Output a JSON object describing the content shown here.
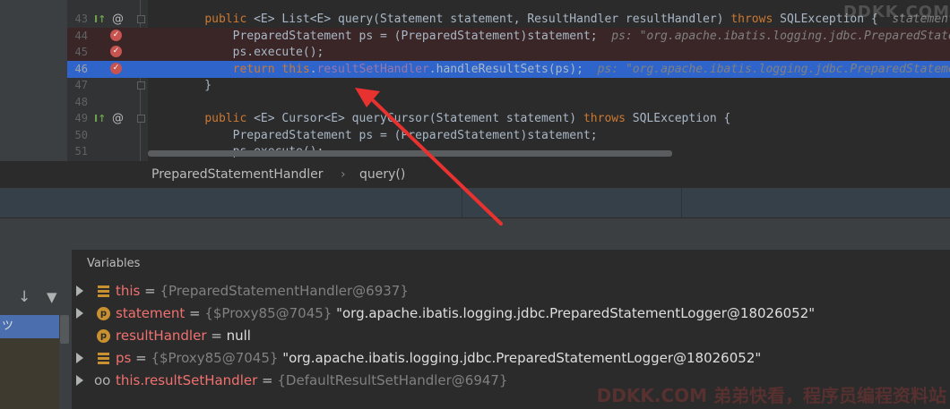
{
  "editor": {
    "watermark": "DDKK.COM",
    "lines": [
      {
        "num": "43",
        "icons": "override",
        "segments": [
          {
            "t": "    "
          },
          {
            "t": "public",
            "c": "kw"
          },
          {
            "t": " <E> List<E> query(Statement statement, ResultHandler resultHandler) "
          },
          {
            "t": "throws",
            "c": "kw"
          },
          {
            "t": " SQLException {  "
          },
          {
            "t": "statement:",
            "c": "cm"
          }
        ]
      },
      {
        "num": "44",
        "icons": "breakpoint",
        "state": "error",
        "segments": [
          {
            "t": "        PreparedStatement ps = (PreparedStatement)statement;  "
          },
          {
            "t": "ps: \"org.apache.ibatis.logging.jdbc.PreparedStatem",
            "c": "cm"
          }
        ]
      },
      {
        "num": "45",
        "icons": "breakpoint",
        "state": "error",
        "segments": [
          {
            "t": "        ps.execute();"
          }
        ]
      },
      {
        "num": "46",
        "icons": "breakpoint",
        "state": "current",
        "segments": [
          {
            "t": "        "
          },
          {
            "t": "return",
            "c": "kw"
          },
          {
            "t": " "
          },
          {
            "t": "this",
            "c": "kw"
          },
          {
            "t": "."
          },
          {
            "t": "resultSetHandler",
            "c": "fld"
          },
          {
            "t": ".handleResultSets(ps);  "
          },
          {
            "t": "ps: \"org.apache.ibatis.logging.jdbc.PreparedStatemen",
            "c": "cm"
          }
        ]
      },
      {
        "num": "47",
        "icons": "fold",
        "segments": [
          {
            "t": "    }"
          }
        ]
      },
      {
        "num": "48",
        "icons": "",
        "segments": [
          {
            "t": ""
          }
        ]
      },
      {
        "num": "49",
        "icons": "override",
        "segments": [
          {
            "t": "    "
          },
          {
            "t": "public",
            "c": "kw"
          },
          {
            "t": " <E> Cursor<E> queryCursor(Statement statement) "
          },
          {
            "t": "throws",
            "c": "kw"
          },
          {
            "t": " SQLException {"
          }
        ]
      },
      {
        "num": "50",
        "icons": "",
        "segments": [
          {
            "t": "        PreparedStatement ps = (PreparedStatement)statement;"
          }
        ]
      },
      {
        "num": "51",
        "icons": "",
        "segments": [
          {
            "t": "        ps.execute();"
          }
        ]
      }
    ]
  },
  "breadcrumb": {
    "items": [
      "PreparedStatementHandler",
      "query()"
    ],
    "separator": "›"
  },
  "frames": {
    "toolbar": {
      "down_icon": "↓",
      "filter_icon": "▼"
    },
    "selected_label": "ツ"
  },
  "variables": {
    "title": "Variables",
    "rows": [
      {
        "kind": "field",
        "expandable": true,
        "name": "this",
        "eq": " = ",
        "type": "{PreparedStatementHandler@6937}",
        "value": ""
      },
      {
        "kind": "param",
        "expandable": true,
        "name": "statement",
        "eq": " = ",
        "type": "{$Proxy85@7045}",
        "value": " \"org.apache.ibatis.logging.jdbc.PreparedStatementLogger@18026052\""
      },
      {
        "kind": "param",
        "expandable": false,
        "name": "resultHandler",
        "eq": " = ",
        "type": "",
        "value": "null"
      },
      {
        "kind": "field",
        "expandable": true,
        "name": "ps",
        "eq": " = ",
        "type": "{$Proxy85@7045}",
        "value": " \"org.apache.ibatis.logging.jdbc.PreparedStatementLogger@18026052\""
      },
      {
        "kind": "watch",
        "expandable": true,
        "name": "this.resultSetHandler",
        "eq": " = ",
        "type": "{DefaultResultSetHandler@6947}",
        "value": ""
      }
    ],
    "watermark": "DDKK.COM 弟弟快看，程序员编程资料站"
  },
  "colors": {
    "keyword": "#cc7832",
    "field": "#9876aa",
    "current_line": "#2f65ca",
    "variable_name": "#f0716f",
    "annotation_arrow": "#e8322f"
  }
}
